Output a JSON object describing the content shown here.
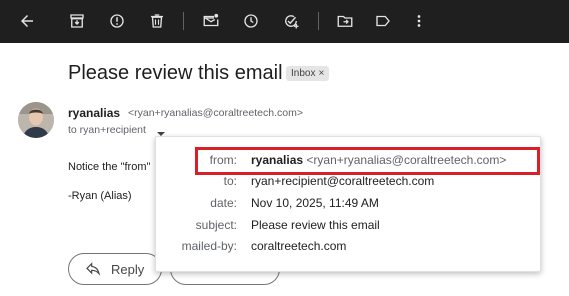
{
  "toolbar": {
    "icons": [
      "back-arrow-icon",
      "archive-icon",
      "report-spam-icon",
      "delete-icon",
      "mark-unread-icon",
      "snooze-icon",
      "add-task-icon",
      "move-to-icon",
      "label-icon",
      "more-vert-icon"
    ]
  },
  "email": {
    "subject": "Please review this email",
    "label_badge": "Inbox",
    "label_remove": "×",
    "sender_name": "ryanalias",
    "sender_email": "<ryan+ryanalias@coraltreetech.com>",
    "to_line": "to ryan+recipient",
    "body_line_1": "Notice the \"from\"",
    "body_line_2": "-Ryan (Alias)"
  },
  "details": {
    "from_label": "from:",
    "from_name": "ryanalias",
    "from_email": "<ryan+ryanalias@coraltreetech.com>",
    "to_label": "to:",
    "to_value": "ryan+recipient@coraltreetech.com",
    "date_label": "date:",
    "date_value": "Nov 10, 2025, 11:49 AM",
    "subject_label": "subject:",
    "subject_value": "Please review this email",
    "mailedby_label": "mailed-by:",
    "mailedby_value": "coraltreetech.com"
  },
  "actions": {
    "reply_label": "Reply"
  },
  "colors": {
    "toolbar_bg": "#1f1f1f",
    "highlight": "#d92028"
  }
}
